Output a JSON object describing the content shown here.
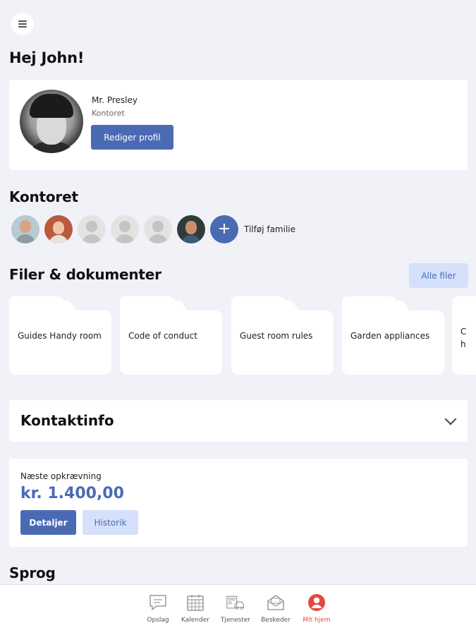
{
  "greeting": "Hej John!",
  "profile": {
    "name": "Mr. Presley",
    "group": "Kontoret",
    "edit_label": "Rediger profil"
  },
  "household": {
    "title": "Kontoret",
    "add_label": "Tilføj familie",
    "add_symbol": "+",
    "members": [
      "member-photo",
      "member-photo",
      "member-placeholder",
      "member-placeholder",
      "member-placeholder",
      "member-photo"
    ]
  },
  "files": {
    "title": "Filer & dokumenter",
    "all_label": "Alle filer",
    "items": [
      "Guides Handy room",
      "Code of conduct",
      "Guest room rules",
      "Garden appliances"
    ],
    "partial_item": "C\nh"
  },
  "contact": {
    "title": "Kontaktinfo"
  },
  "billing": {
    "label": "Næste opkrævning",
    "amount": "kr. 1.400,00",
    "details_label": "Detaljer",
    "history_label": "Historik"
  },
  "language": {
    "title": "Sprog"
  },
  "nav": {
    "items": [
      {
        "label": "Opslag",
        "icon": "chat-bubble-icon"
      },
      {
        "label": "Kalender",
        "icon": "calendar-icon"
      },
      {
        "label": "Tjenester",
        "icon": "services-icon"
      },
      {
        "label": "Beskeder",
        "icon": "envelope-icon"
      },
      {
        "label": "Mit hjem",
        "icon": "user-circle-icon"
      }
    ],
    "active_index": 4
  },
  "colors": {
    "accent": "#4a6bb4",
    "accent_light": "#d5e0fb",
    "active_nav": "#e24a3d",
    "background": "#f1f2f8"
  }
}
